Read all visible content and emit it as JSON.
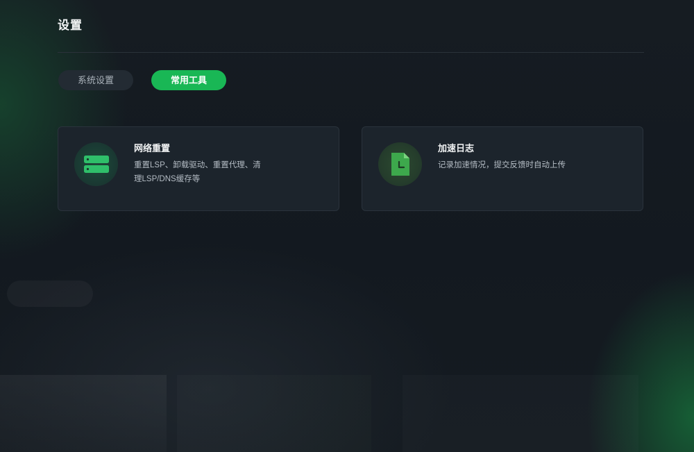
{
  "page": {
    "title": "设置"
  },
  "tabs": [
    {
      "label": "系统设置",
      "active": false
    },
    {
      "label": "常用工具",
      "active": true
    }
  ],
  "tools": [
    {
      "title": "网络重置",
      "description": "重置LSP、卸载驱动、重置代理、清理LSP/DNS缓存等",
      "icon": "server-icon"
    },
    {
      "title": "加速日志",
      "description": "记录加速情况，提交反馈时自动上传",
      "icon": "log-file-clock-icon"
    }
  ],
  "colors": {
    "accent": "#19b755",
    "background": "#141a21",
    "card": "#1c242c"
  }
}
